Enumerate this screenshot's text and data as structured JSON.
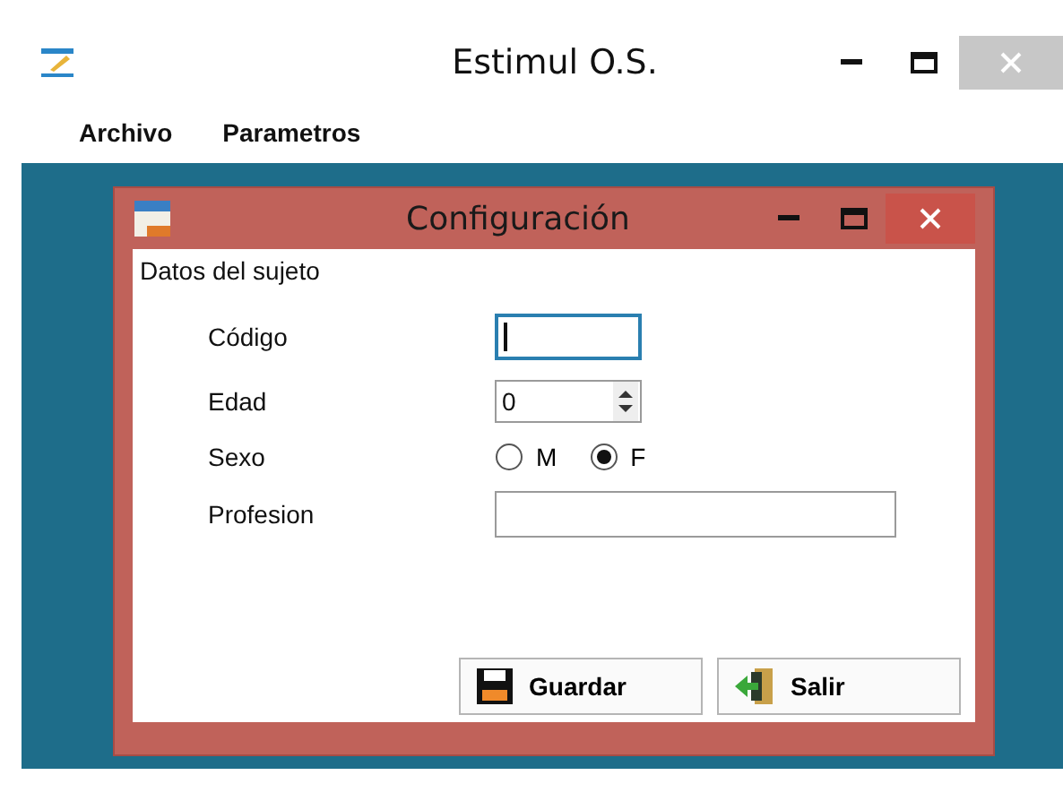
{
  "window": {
    "title": "Estimul O.S."
  },
  "menu": [
    {
      "label": "Archivo"
    },
    {
      "label": "Parametros"
    }
  ],
  "dialog": {
    "title": "Configuración",
    "group": "Datos del sujeto",
    "fields": [
      {
        "kind": "short-text",
        "label": "Código",
        "focused": true
      },
      {
        "kind": "spinner",
        "label": "Edad",
        "value": "0"
      },
      {
        "kind": "radio",
        "label": "Sexo",
        "options": [
          {
            "label": "M",
            "selected": false
          },
          {
            "label": "F",
            "selected": true
          }
        ]
      },
      {
        "kind": "long-text",
        "label": "Profesion",
        "focused": false
      }
    ],
    "buttons": [
      {
        "kind": "save",
        "label": "Guardar"
      },
      {
        "kind": "exit",
        "label": "Salir"
      }
    ]
  }
}
